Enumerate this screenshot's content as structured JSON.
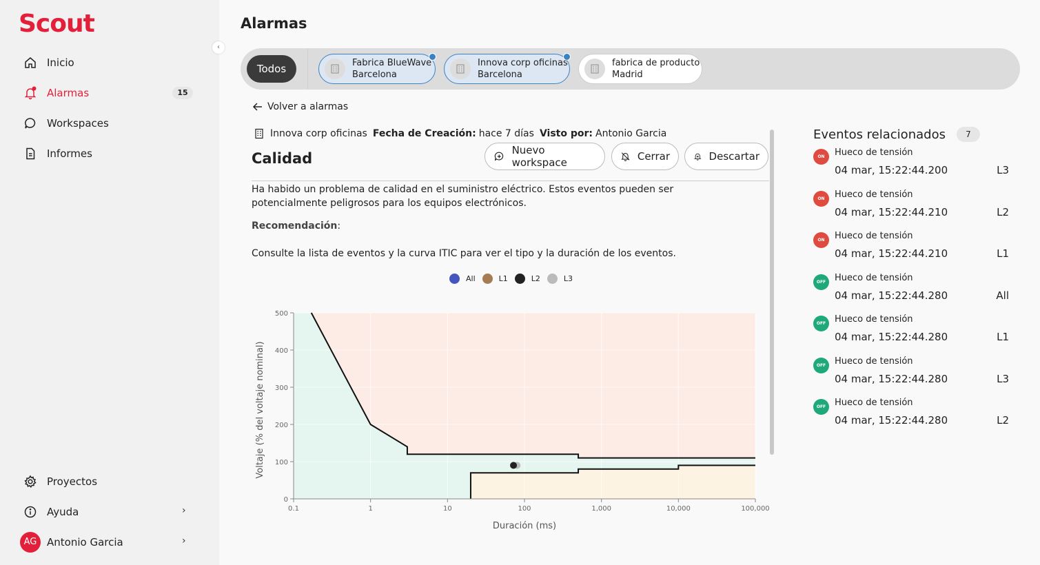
{
  "app": {
    "logo": "Scout",
    "collapse_glyph": "‹"
  },
  "sidebar": {
    "items": [
      {
        "label": "Inicio",
        "icon": "home-icon"
      },
      {
        "label": "Alarmas",
        "icon": "bell-icon",
        "count": "15"
      },
      {
        "label": "Workspaces",
        "icon": "chat-icon"
      },
      {
        "label": "Informes",
        "icon": "document-icon"
      }
    ],
    "bottom": [
      {
        "label": "Proyectos",
        "icon": "gear-icon"
      },
      {
        "label": "Ayuda",
        "icon": "info-icon"
      }
    ],
    "user": {
      "initials": "AG",
      "name": "Antonio Garcia"
    },
    "chevron": "›"
  },
  "page": {
    "title": "Alarmas"
  },
  "tabs": {
    "all_label": "Todos",
    "sites": [
      {
        "line1": "Fabrica BlueWave",
        "line2": "Barcelona",
        "selected": true
      },
      {
        "line1": "Innova corp oficinas",
        "line2": "Barcelona",
        "selected": true
      },
      {
        "line1": "fabrica de producto",
        "line2": "Madrid",
        "selected": false
      }
    ]
  },
  "detail": {
    "back_label": "Volver a alarmas",
    "site": "Innova corp oficinas",
    "created_label": "Fecha de Creación:",
    "created_value": "hace 7 días",
    "seen_label": "Visto por:",
    "seen_value": "Antonio Garcia",
    "title": "Calidad",
    "buttons": {
      "new_workspace": "Nuevo workspace",
      "close": "Cerrar",
      "dismiss": "Descartar"
    },
    "description": "Ha habido un problema de calidad en el suministro eléctrico. Estos eventos pueden ser potencialmente peligrosos para los equipos electrónicos.",
    "recommendation_label": "Recomendación",
    "recommendation_suffix": ":",
    "recommendation_text": "Consulte la lista de eventos y la curva ITIC para ver el tipo y la duración de los eventos."
  },
  "chart_data": {
    "type": "scatter",
    "xlabel": "Duración (ms)",
    "ylabel": "Voltaje (% del voltaje nominal)",
    "x_scale": "log",
    "xlim": [
      0.1,
      100000
    ],
    "ylim": [
      0,
      500
    ],
    "x_ticks": [
      0.1,
      1,
      10,
      100,
      1000,
      10000,
      100000
    ],
    "x_tick_labels": [
      "0.1",
      "1",
      "10",
      "100",
      "1,000",
      "10,000",
      "100,000"
    ],
    "y_ticks": [
      0,
      100,
      200,
      300,
      400,
      500
    ],
    "y_tick_labels": [
      "0",
      "100",
      "200",
      "300",
      "400",
      "500"
    ],
    "grid": true,
    "legend": [
      {
        "name": "All",
        "color": "#4455c0"
      },
      {
        "name": "L1",
        "color": "#a67c52"
      },
      {
        "name": "L2",
        "color": "#222222"
      },
      {
        "name": "L3",
        "color": "#bbbbbb"
      }
    ],
    "upper_curve": [
      [
        0.17,
        500
      ],
      [
        1,
        200
      ],
      [
        3,
        140
      ],
      [
        3,
        120
      ],
      [
        500,
        120
      ],
      [
        500,
        110
      ],
      [
        100000,
        110
      ]
    ],
    "lower_curve": [
      [
        20,
        0
      ],
      [
        20,
        70
      ],
      [
        500,
        70
      ],
      [
        500,
        80
      ],
      [
        10000,
        80
      ],
      [
        10000,
        90
      ],
      [
        100000,
        90
      ]
    ],
    "points": [
      {
        "series": "L3",
        "x": 80,
        "y": 90,
        "color": "#bbbbbb"
      },
      {
        "series": "L2",
        "x": 72,
        "y": 90,
        "color": "#222222"
      }
    ],
    "region_colors": {
      "prohibited": "#fdece6",
      "no_interruption": "#e4f6ef",
      "no_damage": "#fdf3e2"
    }
  },
  "events": {
    "title": "Eventos relacionados",
    "count": "7",
    "items": [
      {
        "status": "ON",
        "title": "Hueco de tensión",
        "time": "04 mar, 15:22:44.200",
        "phase": "L3"
      },
      {
        "status": "ON",
        "title": "Hueco de tensión",
        "time": "04 mar, 15:22:44.210",
        "phase": "L2"
      },
      {
        "status": "ON",
        "title": "Hueco de tensión",
        "time": "04 mar, 15:22:44.210",
        "phase": "L1"
      },
      {
        "status": "OFF",
        "title": "Hueco de tensión",
        "time": "04 mar, 15:22:44.280",
        "phase": "All"
      },
      {
        "status": "OFF",
        "title": "Hueco de tensión",
        "time": "04 mar, 15:22:44.280",
        "phase": "L1"
      },
      {
        "status": "OFF",
        "title": "Hueco de tensión",
        "time": "04 mar, 15:22:44.280",
        "phase": "L3"
      },
      {
        "status": "OFF",
        "title": "Hueco de tensión",
        "time": "04 mar, 15:22:44.280",
        "phase": "L2"
      }
    ]
  }
}
